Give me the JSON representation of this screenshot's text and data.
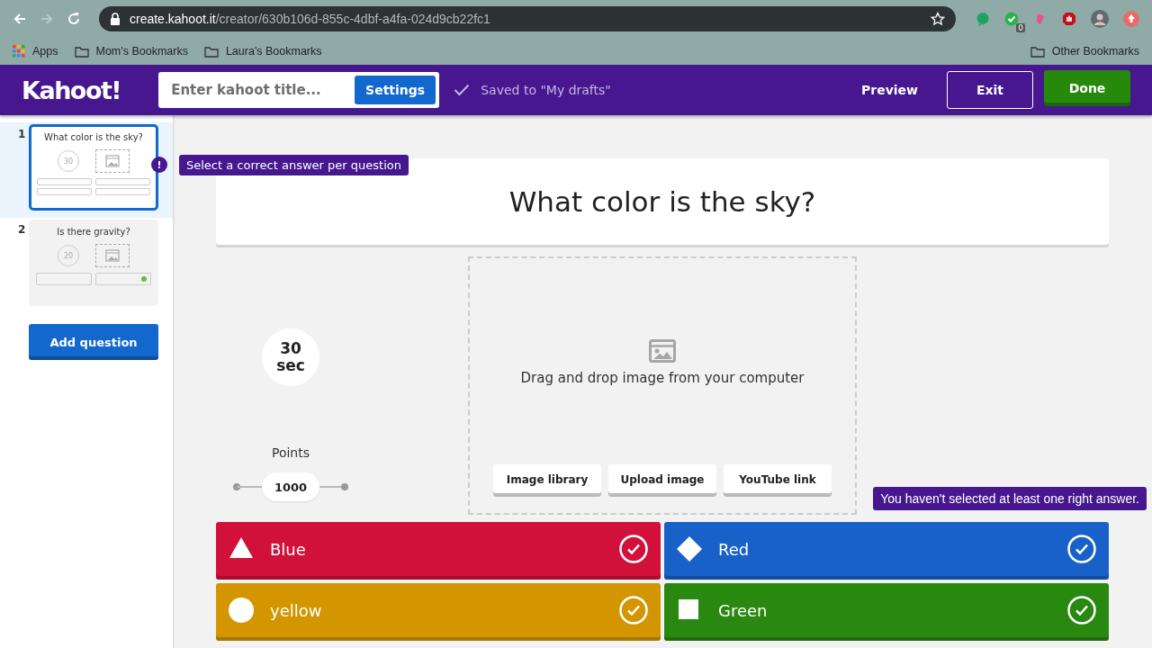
{
  "browser": {
    "url_host": "create.kahoot.it",
    "url_path": "/creator/630b106d-855c-4dbf-a4fa-024d9cb22fc1",
    "extension_badge": "0",
    "bookmarks": [
      {
        "label": "Apps",
        "kind": "apps"
      },
      {
        "label": "Mom's Bookmarks",
        "kind": "folder"
      },
      {
        "label": "Laura's Bookmarks",
        "kind": "folder"
      }
    ],
    "other_bookmarks": "Other Bookmarks"
  },
  "header": {
    "logo": "Kahoot!",
    "title_placeholder": "Enter kahoot title...",
    "settings": "Settings",
    "saved": "Saved to \"My drafts\"",
    "preview": "Preview",
    "exit": "Exit",
    "done": "Done"
  },
  "slides": [
    {
      "number": "1",
      "question": "What color is the sky?",
      "time": "30",
      "selected": true,
      "answers": [
        {
          "correct": false
        },
        {
          "correct": false
        },
        {
          "correct": false
        },
        {
          "correct": false
        }
      ]
    },
    {
      "number": "2",
      "question": "Is there gravity?",
      "time": "20",
      "selected": false,
      "answers": [
        {
          "correct": false
        },
        {
          "correct": true
        }
      ]
    }
  ],
  "add_question": "Add question",
  "warning_icon": "!",
  "warning_tooltip": "Select a correct answer per question",
  "question": "What color is the sky?",
  "time_limit": {
    "value": "30",
    "unit": "sec"
  },
  "points": {
    "label": "Points",
    "value": "1000"
  },
  "media": {
    "prompt": "Drag and drop image from your computer",
    "buttons": [
      "Image library",
      "Upload image",
      "YouTube link"
    ]
  },
  "answer_tooltip": "You haven't selected at least one right answer.",
  "answers": [
    {
      "text": "Blue",
      "kind": "triangle",
      "color": "#d1113a",
      "correct": false
    },
    {
      "text": "Red",
      "kind": "diamond",
      "color": "#1861c9",
      "correct": false
    },
    {
      "text": "yellow",
      "kind": "circle",
      "color": "#d39600",
      "correct": false
    },
    {
      "text": "Green",
      "kind": "square",
      "color": "#29880f",
      "correct": false
    }
  ]
}
